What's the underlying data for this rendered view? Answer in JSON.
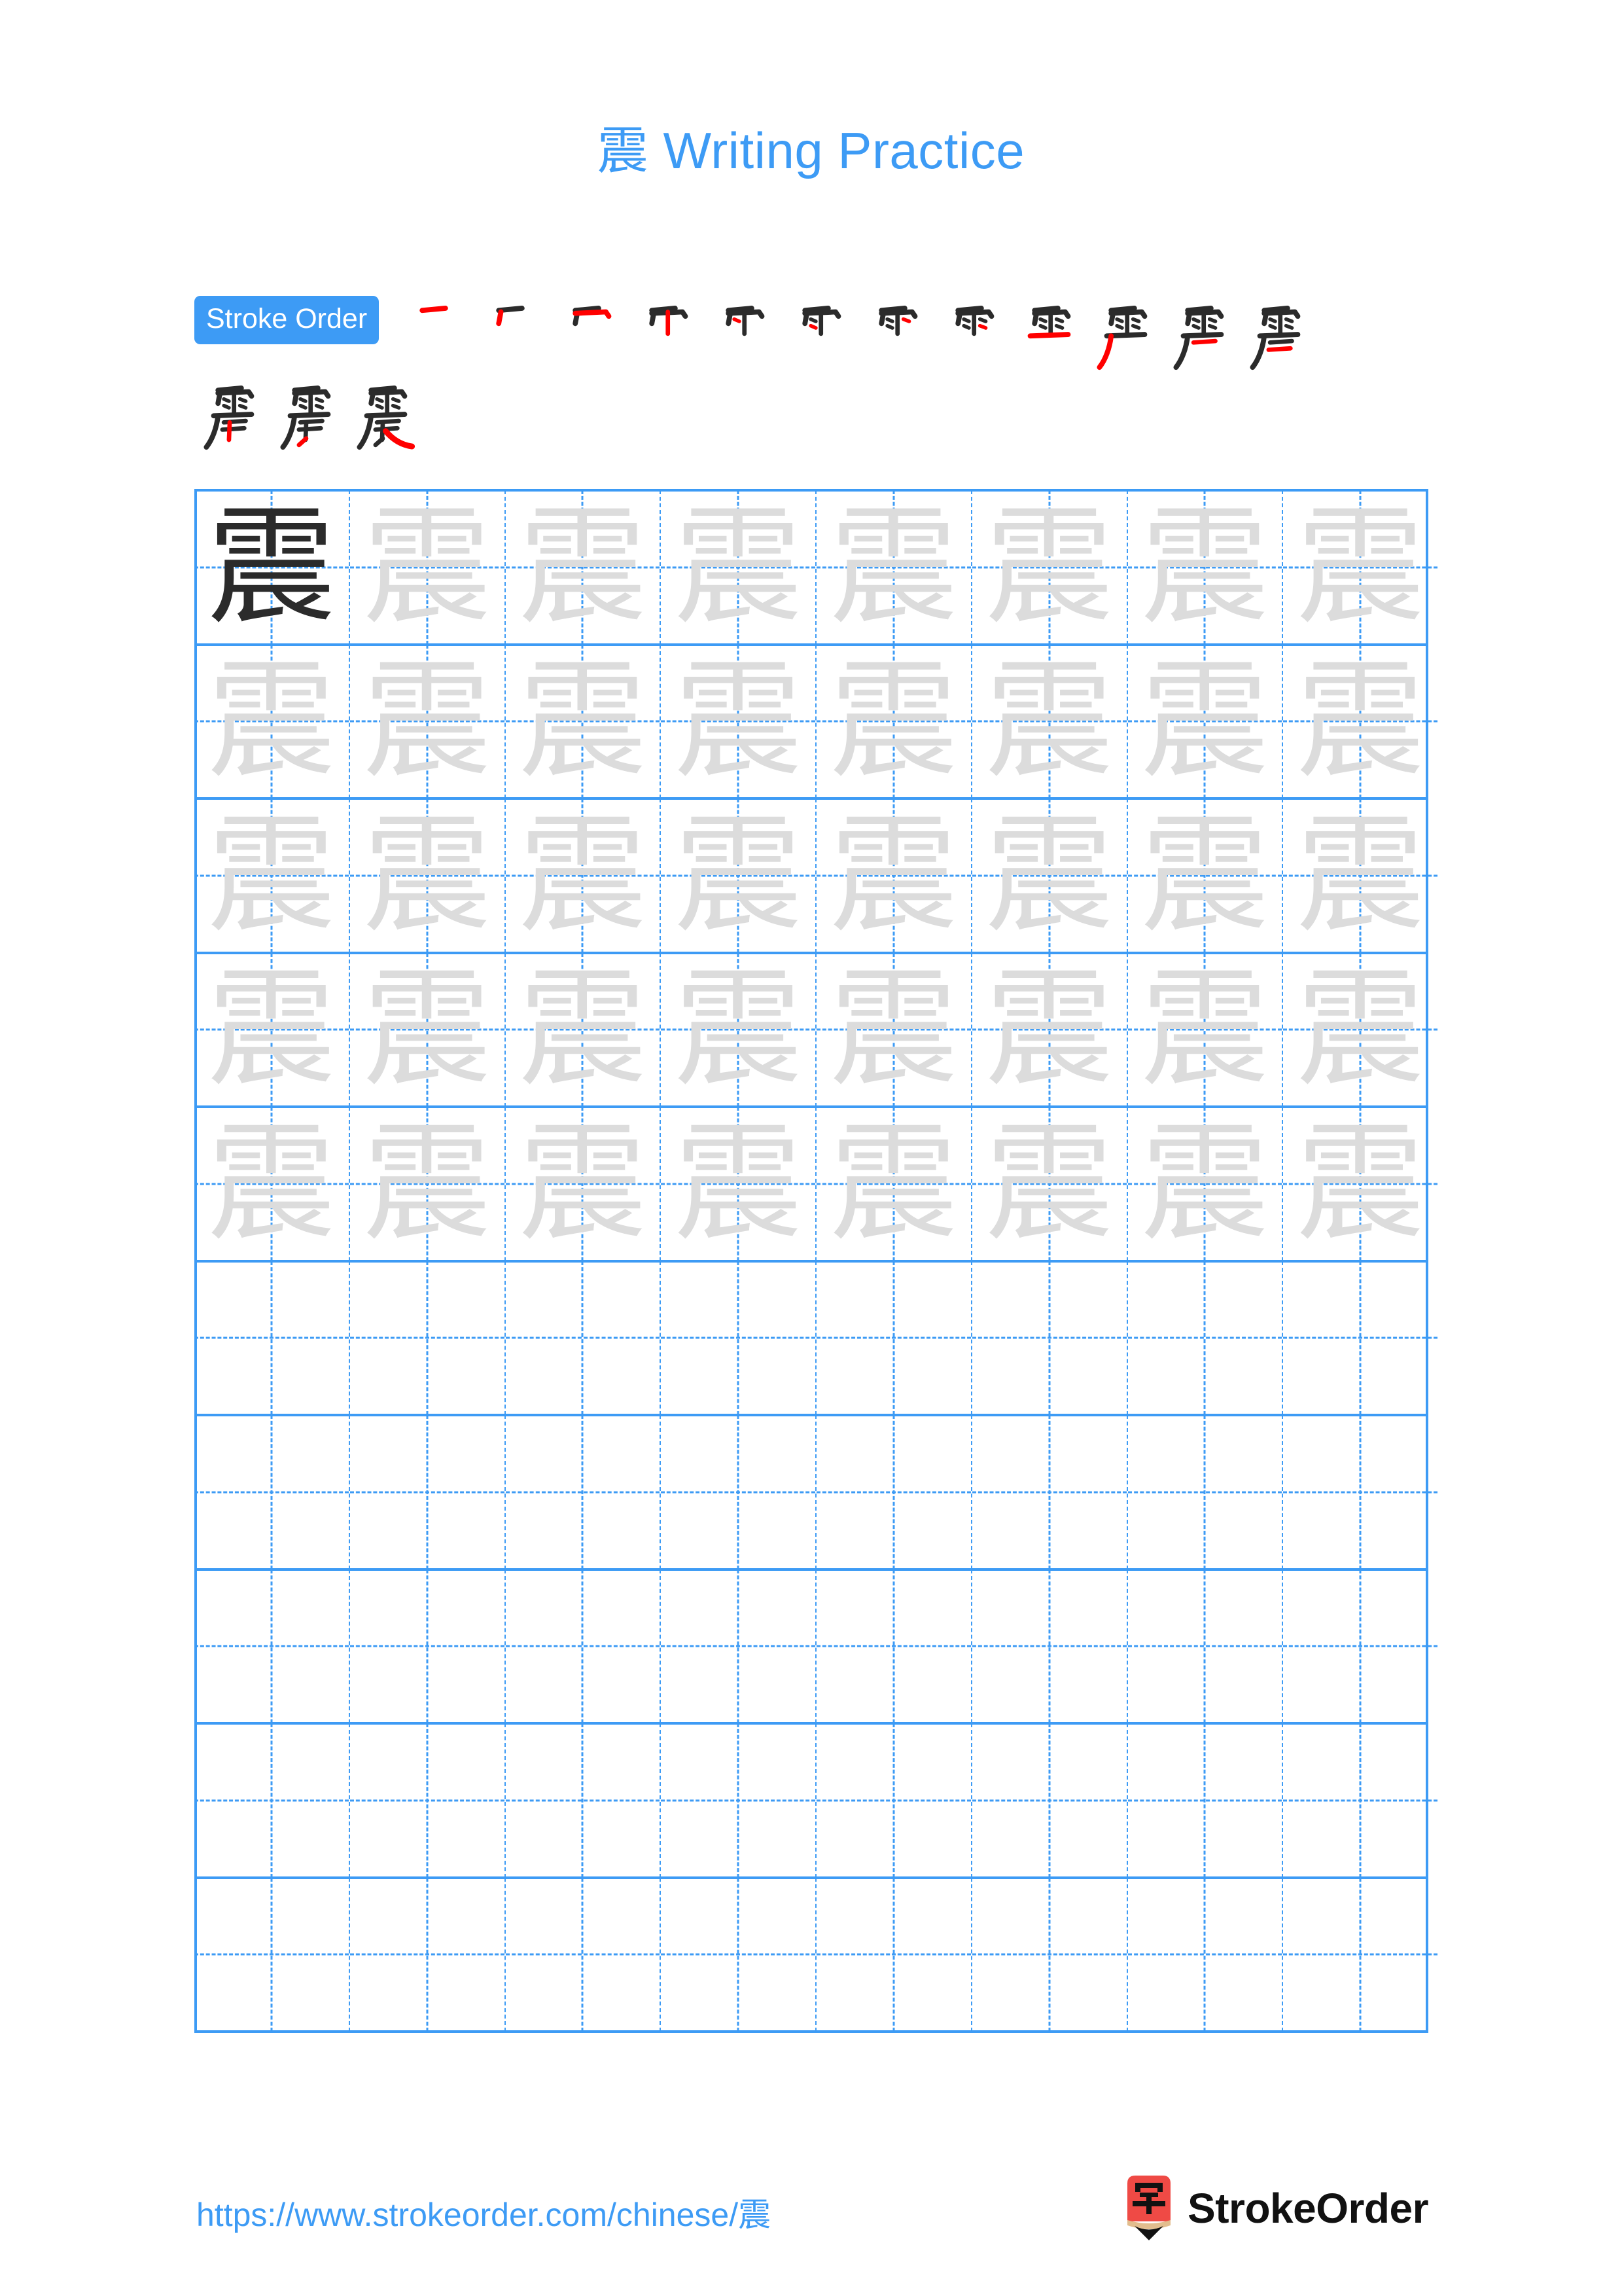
{
  "document": {
    "character": "震",
    "title": "震 Writing Practice",
    "title_character": "震",
    "title_suffix": " Writing Practice",
    "accent_color": "#3d9bf5",
    "stroke_highlight_color": "#ff0000",
    "stroke_ink_color": "#2b2b2b",
    "trace_char_color": "#dcdcdc",
    "model_char_color": "#2b2b2b"
  },
  "stroke_order": {
    "badge_label": "Stroke Order",
    "total_strokes": 15,
    "row1_count": 12,
    "row2_count": 3,
    "steps": [
      1,
      2,
      3,
      4,
      5,
      6,
      7,
      8,
      9,
      10,
      11,
      12,
      13,
      14,
      15
    ]
  },
  "practice_grid": {
    "columns": 8,
    "rows": 10,
    "filled_rows": 5,
    "blank_rows": 5,
    "model_cell": {
      "row": 1,
      "col": 1,
      "char": "震"
    },
    "trace_char": "震",
    "cell_guides": "dashed-cross"
  },
  "footer": {
    "url": "https://www.strokeorder.com/chinese/震",
    "brand_name": "StrokeOrder",
    "logo_character": "字",
    "logo_body_color": "#ef4a45",
    "logo_wood_color": "#e2bd8e",
    "logo_tip_color": "#111111"
  }
}
